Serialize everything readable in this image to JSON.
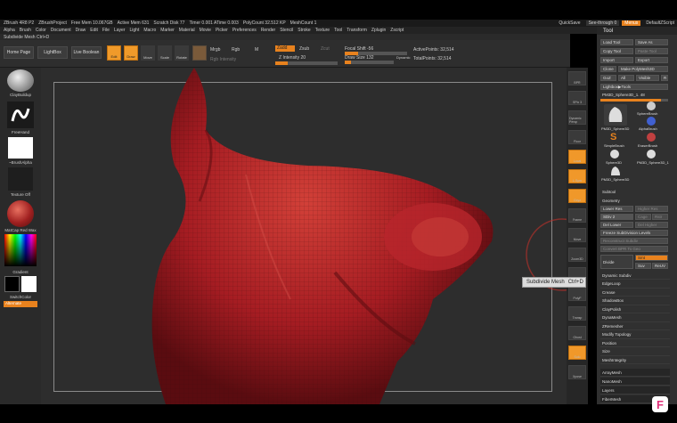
{
  "app": {
    "title": "ZBrush 4R8 P2",
    "project": "ZBrushProject",
    "stats": [
      "Free Mem 10.067GB",
      "Active Mem 631",
      "Scratch Disk 77",
      "Timer 0.001 ATime 0.003",
      "PolyCount 32.512 KP",
      "MeshCount 1"
    ]
  },
  "titlebar_right": {
    "quicksave": "QuickSave",
    "seethrough": "See-through 0",
    "menus": "Menus",
    "script": "DefaultZScript"
  },
  "menubar": [
    "Alpha",
    "Brush",
    "Color",
    "Document",
    "Draw",
    "Edit",
    "File",
    "Layer",
    "Light",
    "Macro",
    "Marker",
    "Material",
    "Movie",
    "Picker",
    "Preferences",
    "Render",
    "Stencil",
    "Stroke",
    "Texture",
    "Tool",
    "Transform",
    "Zplugin",
    "Zscript"
  ],
  "tool_header": "Subdivide Mesh Ctrl+D",
  "shelf": {
    "home": "Home Page",
    "lightbox": "LightBox",
    "live_boolean": "Live Boolean",
    "modes": [
      "Edit",
      "Draw",
      "Move",
      "Scale",
      "Rotate"
    ],
    "mrgb": "Mrgb",
    "rgb": "Rgb",
    "m": "M",
    "zadd": "Zadd",
    "zsub": "Zsub",
    "zcut": "Zcut",
    "rgb_intensity": "Rgb Intensity",
    "z_intensity": "Z Intensity 20",
    "focal_shift": "Focal Shift -56",
    "draw_size": "Draw Size 132",
    "dynamic": "Dynamic",
    "active_points": "ActivePoints: 32,514",
    "total_points": "TotalPoints: 32,514",
    "z_intensity_level": 0.2,
    "focal_shift_level": 0.22,
    "draw_size_level": 0.12
  },
  "left": {
    "brush": "ClayBuildup",
    "stroke": "FreeHand",
    "alpha": "~BrushAlpha",
    "texture": "Texture Off",
    "material": "MatCap Red Wax",
    "gradient": "Gradient",
    "switch": "SwitchColor",
    "alternate": "Alternate"
  },
  "rightstrip": [
    "BPR",
    "SPix 3",
    "Dynamic Persp",
    "Floor",
    "Local",
    "L.Sym",
    "Gxyz",
    "Frame",
    "Move",
    "Zoom3D",
    "Rotate",
    "PolyF",
    "Transp",
    "Ghost",
    "Solo",
    "Xpose"
  ],
  "tooltip": {
    "label": "Subdivide Mesh",
    "shortcut": "Ctrl+D"
  },
  "toolpanel": {
    "title": "Tool",
    "buttons": [
      "Load Tool",
      "Save As",
      "Copy Tool",
      "Paste Tool",
      "Import",
      "Export",
      "Clone",
      "Make PolyMesh3D",
      "GoZ",
      "All",
      "Visible",
      "R"
    ],
    "lightbox_tools": "Lightbox▶Tools",
    "current_tool": "PM3D_Sphere3D_1. 48",
    "thumbs": [
      "PM3D_Sphere3D",
      "SphereBrush",
      "AlphaBrush",
      "SimpleBrush",
      "EraserBrush",
      "Sphere3D",
      "PM3D_Sphere3D_1"
    ],
    "subtool": "Subtool",
    "geometry": "Geometry",
    "lower_res": "Lower Res",
    "higher_res": "Higher Res",
    "sdiv": "SDiv 2",
    "cage": "Cage",
    "rstr": "Rstr",
    "del_lower": "Del Lower",
    "del_higher": "Del Higher",
    "freeze": "Freeze SubDivision Levels",
    "reconstruct": "Reconstruct Subdiv",
    "convert": "Convert BPR To Geo",
    "divide": "Divide",
    "smt": "Smt",
    "suv": "Suv",
    "reluv": "ReUV",
    "list": [
      "Dynamic Subdiv",
      "EdgeLoop",
      "Crease",
      "ShadowBox",
      "ClayPolish",
      "DynaMesh",
      "ZRemesher",
      "Modify Topology",
      "Position",
      "Size",
      "MeshIntegrity"
    ],
    "bottom": [
      "ArrayMesh",
      "NanoMesh",
      "Layers",
      "FiberMesh"
    ]
  },
  "colors": {
    "accent": "#e8821e",
    "mesh": "#b3232a"
  },
  "badge": "F"
}
